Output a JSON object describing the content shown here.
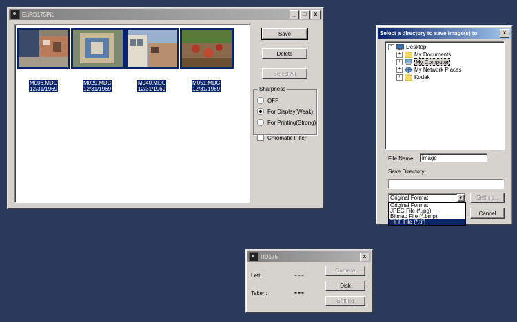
{
  "main_window": {
    "title": "E:\\RD175Pic",
    "minimize": "_",
    "maximize": "□",
    "close": "x",
    "thumbnails": [
      {
        "name": "M006.MDC",
        "date": "12/31/1969"
      },
      {
        "name": "M029.MDC",
        "date": "12/31/1969"
      },
      {
        "name": "M040.MDC",
        "date": "12/31/1969"
      },
      {
        "name": "M051.MDC",
        "date": "12/31/1969"
      }
    ],
    "buttons": {
      "save": "Save",
      "delete": "Delete",
      "select_all": "Select All"
    },
    "sharpness": {
      "label": "Sharpness",
      "options": [
        "OFF",
        "For Display(Weak)",
        "For Printing(Strong)"
      ],
      "selected": "For Display(Weak)"
    },
    "chromatic_filter": "Chromatic Filter"
  },
  "save_dialog": {
    "title": "Select a directory to save image(s) to",
    "close": "x",
    "tree": [
      {
        "label": "Desktop",
        "icon": "desktop-icon",
        "level": 0,
        "expander": "-"
      },
      {
        "label": "My Documents",
        "icon": "folder-icon",
        "level": 1,
        "expander": "+"
      },
      {
        "label": "My Computer",
        "icon": "computer-icon",
        "level": 1,
        "expander": "+"
      },
      {
        "label": "My Network Places",
        "icon": "network-icon",
        "level": 1,
        "expander": "+"
      },
      {
        "label": "Kodak",
        "icon": "folder-icon",
        "level": 1,
        "expander": "+"
      }
    ],
    "file_name_label": "File Name:",
    "file_name_value": "image",
    "save_directory_label": "Save Directory:",
    "save_directory_value": "",
    "format_selected": "Original Format",
    "format_options": [
      "Original Format",
      "JPEG File (*.jpg)",
      "Bitmap File (*.bmp)",
      "TIFF File (*.tif)"
    ],
    "format_highlighted": "TIFF File (*.tif)",
    "setting_button": "Setting...",
    "cancel_button": "Cancel"
  },
  "rd175_window": {
    "title": "RD175",
    "close": "x",
    "left_label": "Left:",
    "left_value": "---",
    "taken_label": "Taken:",
    "taken_value": "---",
    "camera_button": "Camera",
    "disk_button": "Disk",
    "setting_button": "Setting"
  },
  "colors": {
    "desktop": "#2b3a5a",
    "selection": "#0a246a",
    "window_face": "#d6d3ce"
  }
}
